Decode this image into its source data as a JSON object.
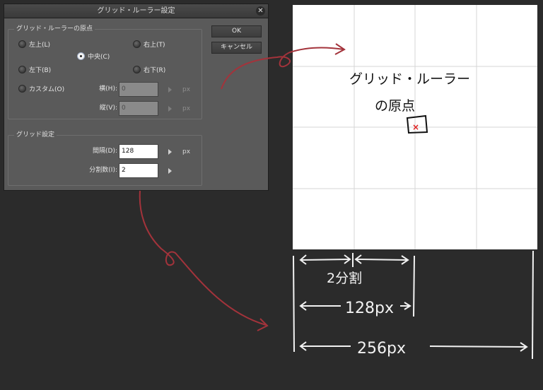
{
  "dialog": {
    "title": "グリッド・ルーラー設定",
    "origin_group": {
      "legend": "グリッド・ルーラーの原点",
      "radios": {
        "top_left": "左上(L)",
        "top_right": "右上(T)",
        "center": "中央(C)",
        "bottom_left": "左下(B)",
        "bottom_right": "右下(R)",
        "custom": "カスタム(O)"
      },
      "selected": "中央(C)",
      "horizontal_label": "横(H):",
      "horizontal_value": "0",
      "vertical_label": "縦(V):",
      "vertical_value": "0",
      "unit": "px"
    },
    "grid_group": {
      "legend": "グリッド設定",
      "spacing_label": "間隔(D):",
      "spacing_value": "128",
      "spacing_unit": "px",
      "divisions_label": "分割数(I):",
      "divisions_value": "2"
    },
    "ok_label": "OK",
    "cancel_label": "キャンセル",
    "close_glyph": "✕"
  },
  "illustration": {
    "note_line1": "グリッド・ルーラー",
    "note_line2": "の原点",
    "origin_mark": "×",
    "division_label": "2分割",
    "spacing_label": "128px",
    "total_label": "256px"
  },
  "colors": {
    "annotation_red": "#a3333b",
    "chalk_white": "#f2f2f2",
    "grid_line": "#d6d6d6"
  }
}
